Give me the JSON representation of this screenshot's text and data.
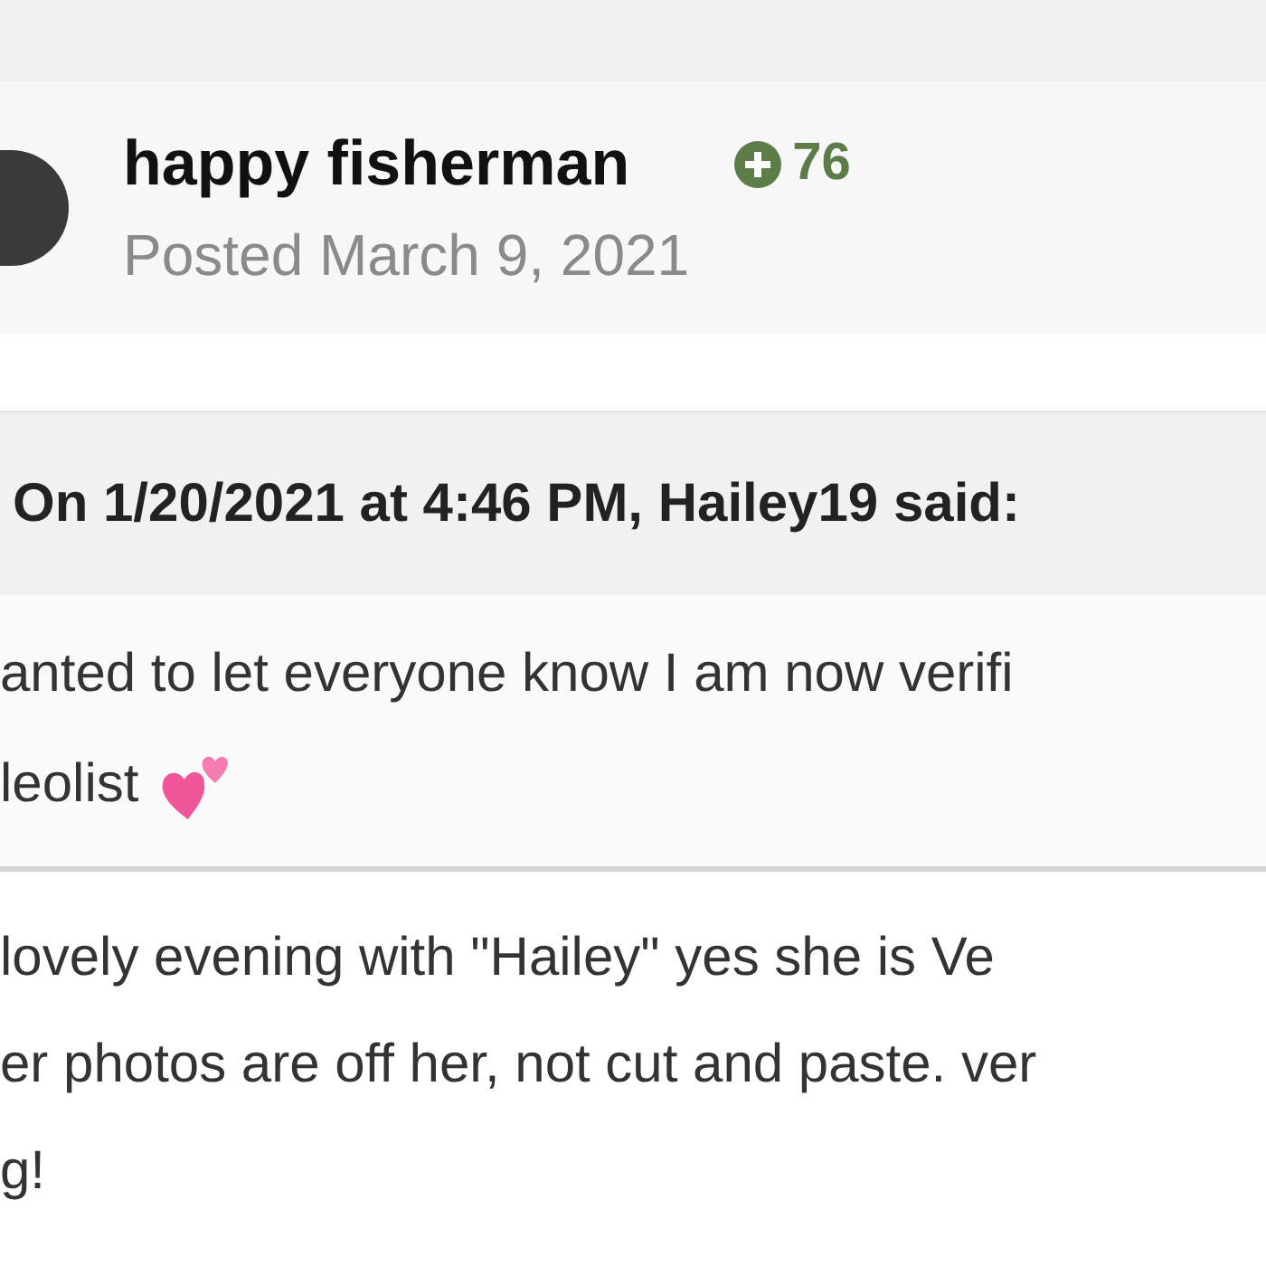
{
  "post": {
    "author": "happy fisherman",
    "reputation": "76",
    "posted": "Posted March 9, 2021"
  },
  "quote": {
    "citation": "On 1/20/2021 at 4:46 PM, Hailey19 said:",
    "lines": [
      "anted to let everyone know I am now verifi",
      "leolist"
    ],
    "hearts": true
  },
  "body": {
    "lines": [
      "lovely evening with \"Hailey\" yes she is Ve",
      "er photos are off her, not cut and paste. ver",
      "g!"
    ]
  }
}
